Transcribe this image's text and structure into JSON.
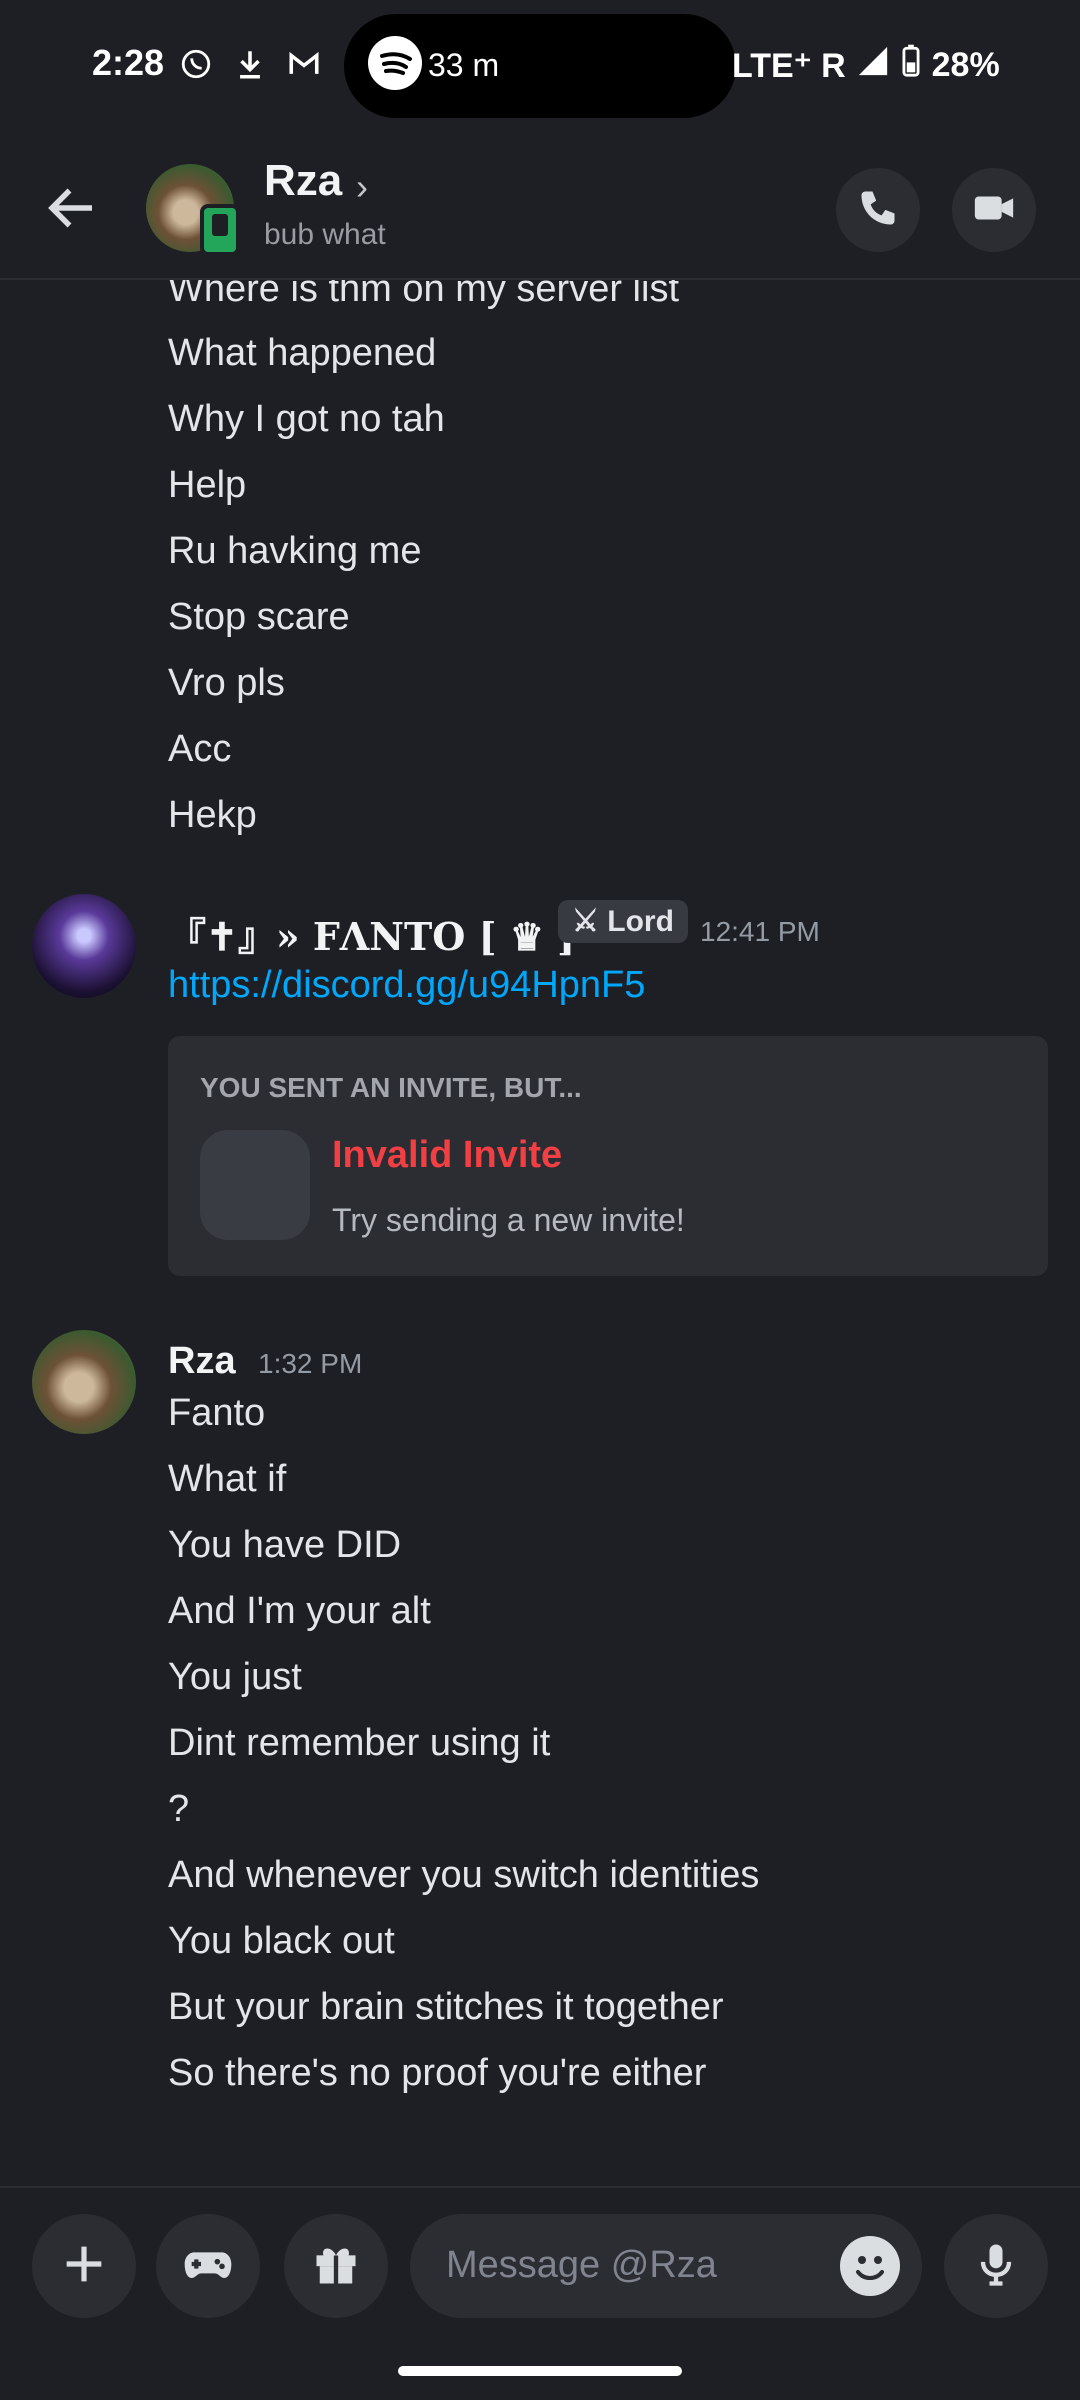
{
  "status_bar": {
    "time": "2:28",
    "spotify_text": "33 m",
    "network": "LTE⁺ R",
    "battery": "28%"
  },
  "header": {
    "name": "Rza",
    "status": "bub what"
  },
  "messages": {
    "continued_lines": [
      "Where is thm on my server list",
      "What happened",
      "Why I got no tah",
      "Help",
      "Ru havking me",
      "Stop scare",
      "Vro pls",
      "Acc",
      "Hekp"
    ],
    "fanto": {
      "name": "『✝』» FΛNTO [ ♛ ]",
      "role": "Lord",
      "time": "12:41 PM",
      "link": "https://discord.gg/u94HpnF5",
      "embed": {
        "header": "YOU SENT AN INVITE, BUT...",
        "title": "Invalid Invite",
        "subtitle": "Try sending a new invite!"
      }
    },
    "rza": {
      "name": "Rza",
      "time": "1:32 PM",
      "lines": [
        "Fanto",
        "What if",
        "You have DID",
        "And I'm your alt",
        "You just",
        "Dint remember using it",
        "?",
        "And whenever you switch identities",
        "You black out",
        "But your brain stitches it together",
        "So there's no proof you're either"
      ]
    }
  },
  "composer": {
    "placeholder": "Message @Rza"
  }
}
